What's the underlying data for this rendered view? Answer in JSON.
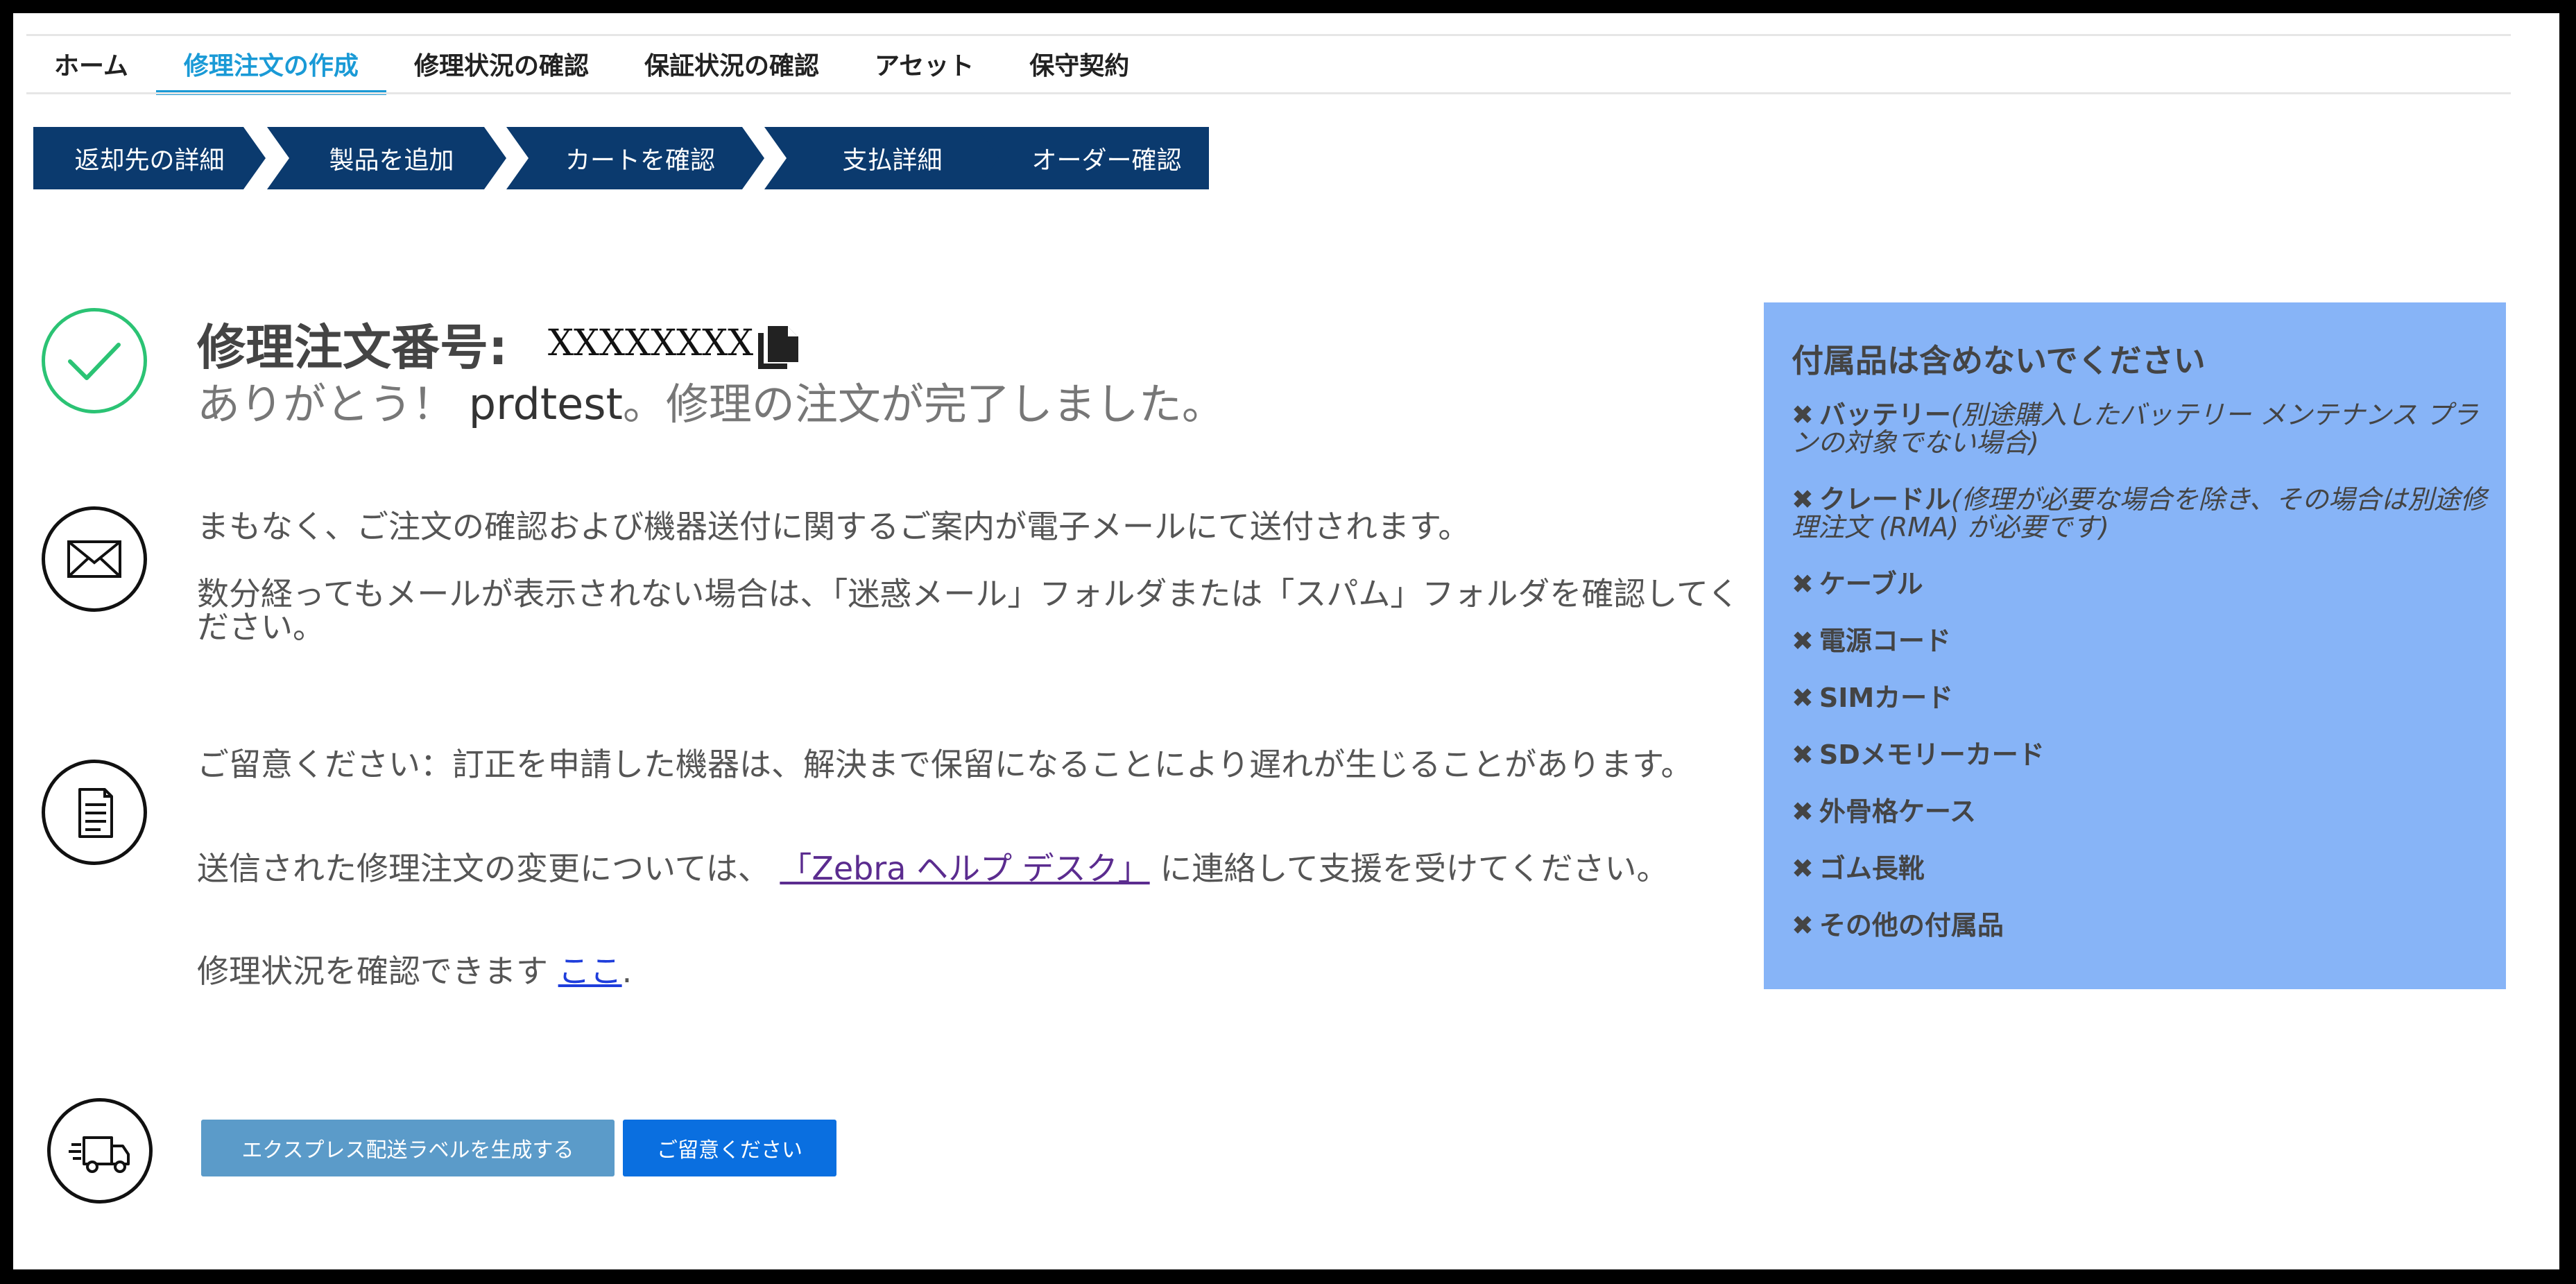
{
  "nav": {
    "items": [
      {
        "label": "ホーム",
        "active": false
      },
      {
        "label": "修理注文の作成",
        "active": true
      },
      {
        "label": "修理状況の確認",
        "active": false
      },
      {
        "label": "保証状況の確認",
        "active": false
      },
      {
        "label": "アセット",
        "active": false
      },
      {
        "label": "保守契約",
        "active": false
      }
    ]
  },
  "steps": [
    {
      "label": "返却先の詳細"
    },
    {
      "label": "製品を追加"
    },
    {
      "label": "カートを確認"
    },
    {
      "label": "支払詳細"
    },
    {
      "label": "オーダー確認"
    }
  ],
  "confirmation": {
    "order_label": "修理注文番号:",
    "order_number": "XXXXXXXX",
    "thanks_prefix": "ありがとう！ ",
    "user_name": "prdtest",
    "thanks_suffix": "。修理の注文が完了しました。",
    "copy_icon": "copy-icon"
  },
  "email_section": {
    "line1": "まもなく、ご注文の確認および機器送付に関するご案内が電子メールにて送付されます。",
    "line2": "数分経ってもメールが表示されない場合は、「迷惑メール」フォルダまたは「スパム」フォルダを確認してください。"
  },
  "notice_section": {
    "line1": "ご留意ください：訂正を申請した機器は、解決まで保留になることにより遅れが生じることがあります。",
    "line2_prefix": "送信された修理注文の変更については、",
    "line2_link": "「Zebra ヘルプ デスク」",
    "line2_suffix": "に連絡して支援を受けてください。",
    "line3_prefix": "修理状況を確認できます ",
    "line3_link": "ここ",
    "line3_suffix": "."
  },
  "buttons": {
    "express_label": "エクスプレス配送ラベルを生成する",
    "notice_label": "ご留意ください"
  },
  "panel": {
    "title": "付属品は含めないでください",
    "items": [
      {
        "name": "バッテリー",
        "note": "(別途購入したバッテリー メンテナンス プランの対象でない場合)"
      },
      {
        "name": "クレードル",
        "note": "(修理が必要な場合を除き、その場合は別途修理注文 (RMA) が必要です)"
      },
      {
        "name": "ケーブル",
        "note": ""
      },
      {
        "name": "電源コード",
        "note": ""
      },
      {
        "name": "SIMカード",
        "note": ""
      },
      {
        "name": "SDメモリーカード",
        "note": ""
      },
      {
        "name": "外骨格ケース",
        "note": ""
      },
      {
        "name": "ゴム長靴",
        "note": ""
      },
      {
        "name": "その他の付属品",
        "note": ""
      }
    ],
    "bullet": "✖"
  },
  "colors": {
    "nav_active": "#1a9ad6",
    "step_bg": "#0b3a6e",
    "success_green": "#2bc374",
    "panel_bg": "#87b4f7",
    "btn_express": "#5b9bc9",
    "btn_notice": "#0a6fe0"
  }
}
